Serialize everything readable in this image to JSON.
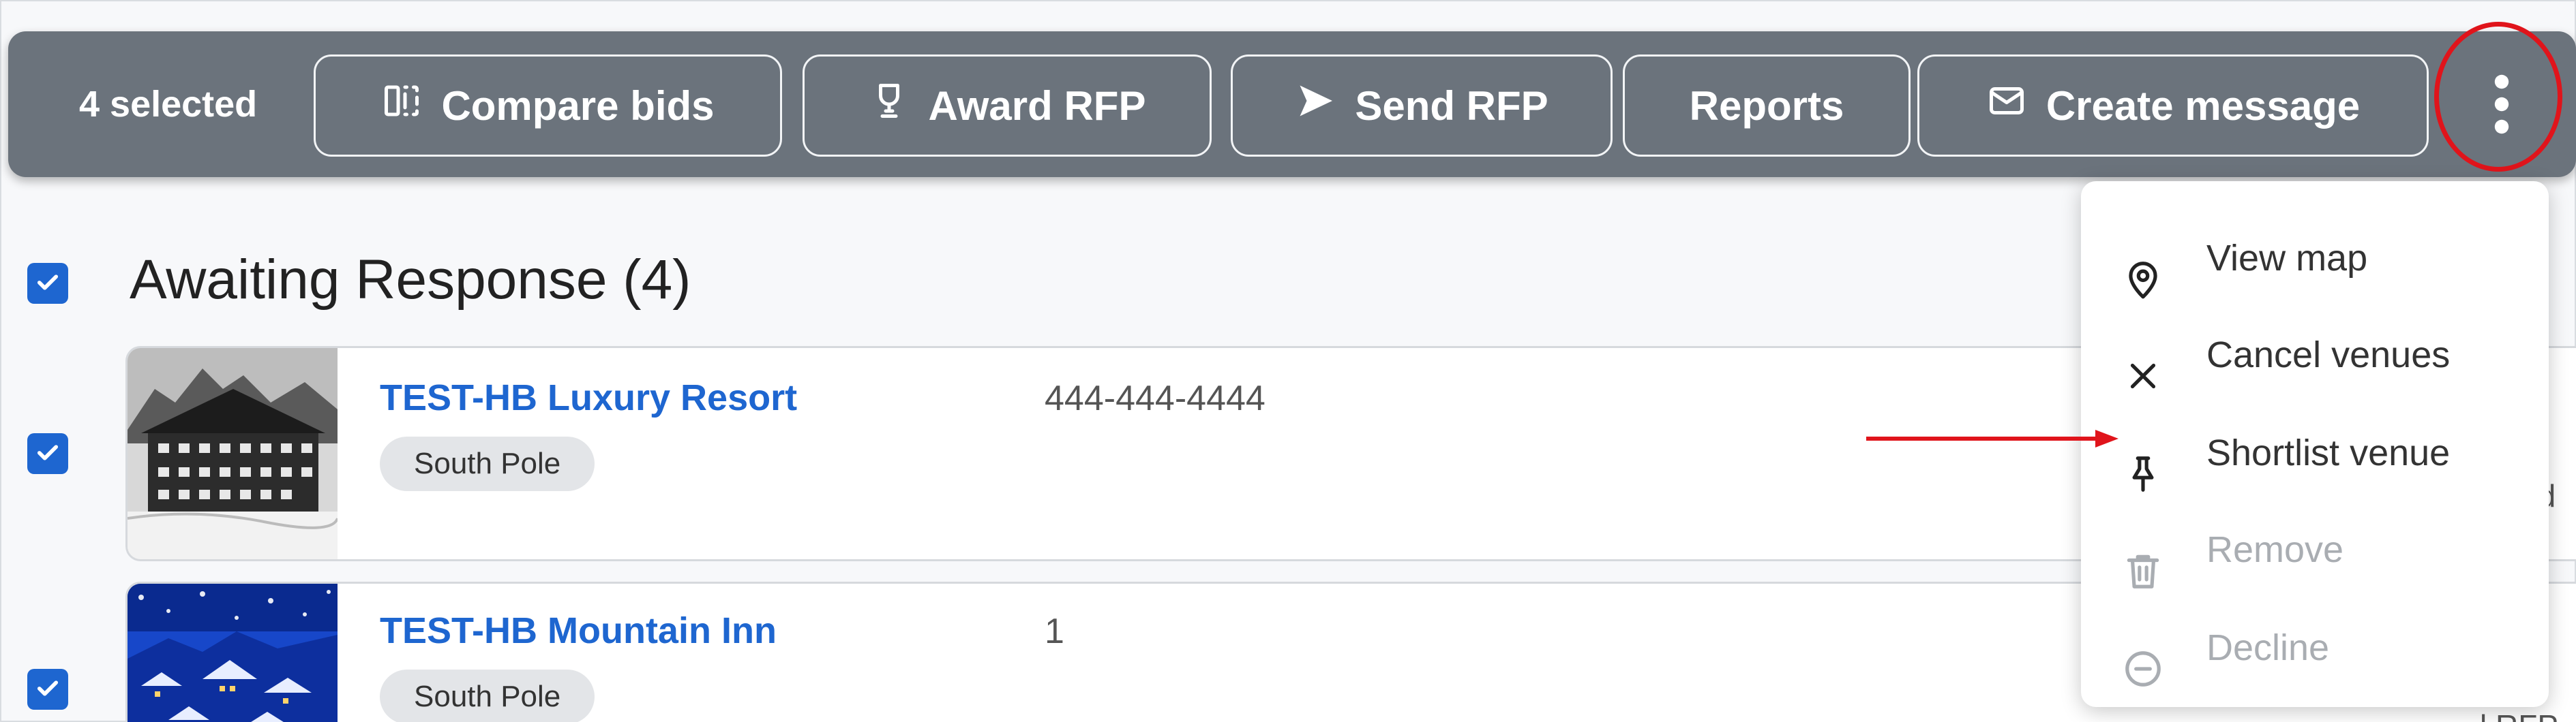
{
  "toolbar": {
    "selected_label": "4 selected",
    "compare_label": "Compare bids",
    "award_label": "Award RFP",
    "send_label": "Send RFP",
    "reports_label": "Reports",
    "message_label": "Create message"
  },
  "group": {
    "title": "Awaiting Response (4)",
    "checked": true
  },
  "venues": [
    {
      "name": "TEST-HB Luxury Resort",
      "location": "South Pole",
      "phone": "444-444-4444",
      "checked": true,
      "side_text": "nd"
    },
    {
      "name": "TEST-HB Mountain Inn",
      "location": "South Pole",
      "phone": "1",
      "checked": true,
      "side_text": "l RFP"
    }
  ],
  "menu": {
    "items": [
      {
        "label": "View map",
        "icon": "map-pin-icon",
        "disabled": false
      },
      {
        "label": "Cancel venues",
        "icon": "close-icon",
        "disabled": false
      },
      {
        "label": "Shortlist venue",
        "icon": "pin-icon",
        "disabled": false
      },
      {
        "label": "Remove",
        "icon": "trash-icon",
        "disabled": true
      },
      {
        "label": "Decline",
        "icon": "minus-circle-icon",
        "disabled": true
      }
    ]
  },
  "colors": {
    "toolbar_bg": "#6b737c",
    "accent": "#1e66d0",
    "annotation": "#e0141b",
    "disabled_text": "#a9adb2"
  }
}
